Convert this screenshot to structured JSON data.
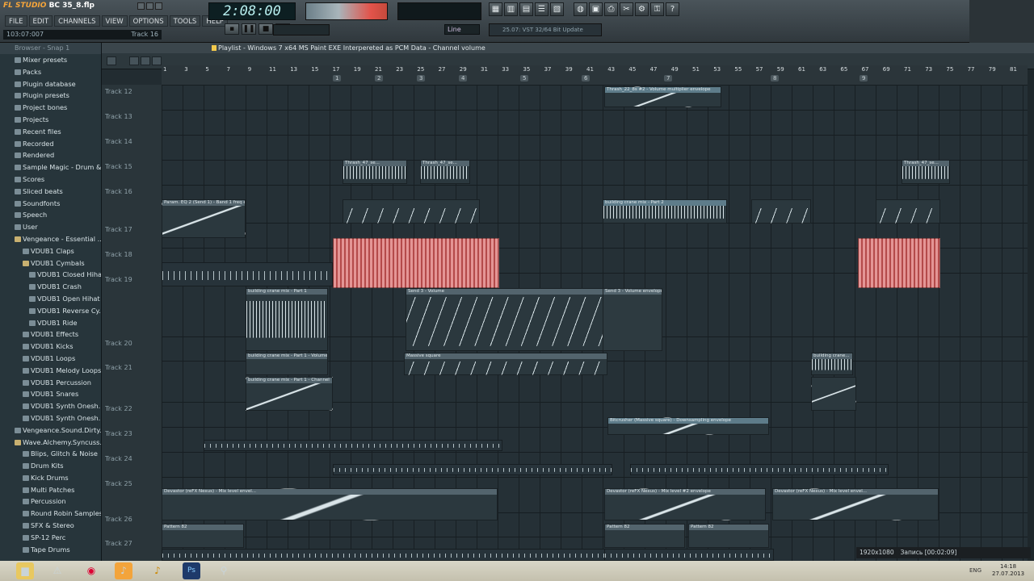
{
  "app": {
    "brand": "FL STUDIO",
    "project": "BC 35_8.flp",
    "hint_left": "103:07:007",
    "hint_right": "Track 16"
  },
  "menu": [
    "FILE",
    "EDIT",
    "CHANNELS",
    "VIEW",
    "OPTIONS",
    "TOOLS",
    "HELP"
  ],
  "transport": {
    "time": "2:08:00",
    "snap": "Line",
    "news": "25.07: VST 32/64 Bit Update"
  },
  "playlist": {
    "title": "Playlist - Windows 7 x64 MS Paint EXE Interpereted as PCM Data - Channel volume",
    "ruler_bars": [
      "1",
      "3",
      "5",
      "7",
      "9",
      "11",
      "13",
      "15",
      "17",
      "19",
      "21",
      "23",
      "25",
      "27",
      "29",
      "31",
      "33",
      "35",
      "37",
      "39",
      "41",
      "43",
      "45",
      "47",
      "49",
      "51",
      "53",
      "55",
      "57",
      "59",
      "61",
      "63",
      "65",
      "67",
      "69",
      "71",
      "73",
      "75",
      "77",
      "79",
      "81"
    ],
    "ruler_sections": [
      "1",
      "2",
      "3",
      "4",
      "5",
      "6",
      "7",
      "8",
      "9"
    ],
    "tracks": [
      "Track 12",
      "Track 13",
      "Track 14",
      "Track 15",
      "Track 16",
      "Track 17",
      "Track 18",
      "Track 19",
      "Track 20",
      "Track 21",
      "Track 22",
      "Track 23",
      "Track 24",
      "Track 25",
      "Track 26",
      "Track 27"
    ]
  },
  "clips": {
    "c1": "Thrash_22_8s #2 - Volume multiplier envelope",
    "c2": "Thrash_47_se...",
    "c3": "Param. EQ 2 (Send 1) - Band 1 freq e...",
    "c4": "building crane mix - Part 2",
    "c5": "building crane mix - Part 1",
    "c6": "Send 3 - Volume",
    "c7": "Send 3 - Volume envelope",
    "c8": "building crane mix - Part 1 - Volume",
    "c9": "Massive square",
    "c10": "building crane mix - Part 1 - Channel",
    "c11": "Bitcrusher (Massive square) - Downsampling envelope",
    "c12": "Devastor (reFX Nexus) - Mix level envel...",
    "c13": "Devastor (reFX Nexus) - Mix level #2 envelope",
    "c14": "Pattern 82",
    "c15": "building crane...",
    "c16": "Thrash_47_se..."
  },
  "browser": {
    "header": "Browser - Snap 1",
    "items": [
      {
        "label": "Mixer presets",
        "lvl": 0
      },
      {
        "label": "Packs",
        "lvl": 0
      },
      {
        "label": "Plugin database",
        "lvl": 0
      },
      {
        "label": "Plugin presets",
        "lvl": 0
      },
      {
        "label": "Project bones",
        "lvl": 0
      },
      {
        "label": "Projects",
        "lvl": 0
      },
      {
        "label": "Recent files",
        "lvl": 0
      },
      {
        "label": "Recorded",
        "lvl": 0
      },
      {
        "label": "Rendered",
        "lvl": 0
      },
      {
        "label": "Sample Magic - Drum & ...",
        "lvl": 0
      },
      {
        "label": "Scores",
        "lvl": 0
      },
      {
        "label": "Sliced beats",
        "lvl": 0
      },
      {
        "label": "Soundfonts",
        "lvl": 0
      },
      {
        "label": "Speech",
        "lvl": 0
      },
      {
        "label": "User",
        "lvl": 0
      },
      {
        "label": "Vengeance - Essential ...",
        "lvl": 0,
        "open": true
      },
      {
        "label": "VDUB1 Claps",
        "lvl": 1
      },
      {
        "label": "VDUB1 Cymbals",
        "lvl": 1,
        "open": true
      },
      {
        "label": "VDUB1 Closed Hihat",
        "lvl": 2
      },
      {
        "label": "VDUB1 Crash",
        "lvl": 2
      },
      {
        "label": "VDUB1 Open Hihat",
        "lvl": 2
      },
      {
        "label": "VDUB1 Reverse Cy...",
        "lvl": 2
      },
      {
        "label": "VDUB1 Ride",
        "lvl": 2
      },
      {
        "label": "VDUB1 Effects",
        "lvl": 1
      },
      {
        "label": "VDUB1 Kicks",
        "lvl": 1
      },
      {
        "label": "VDUB1 Loops",
        "lvl": 1
      },
      {
        "label": "VDUB1 Melody Loops",
        "lvl": 1
      },
      {
        "label": "VDUB1 Percussion",
        "lvl": 1
      },
      {
        "label": "VDUB1 Snares",
        "lvl": 1
      },
      {
        "label": "VDUB1 Synth Onesh...",
        "lvl": 1
      },
      {
        "label": "VDUB1 Synth Onesh...",
        "lvl": 1
      },
      {
        "label": "Vengeance.Sound.Dirty...",
        "lvl": 0
      },
      {
        "label": "Wave.Alchemy.Syncuss...",
        "lvl": 0,
        "open": true
      },
      {
        "label": "Blips, Glitch & Noise",
        "lvl": 1
      },
      {
        "label": "Drum Kits",
        "lvl": 1
      },
      {
        "label": "Kick Drums",
        "lvl": 1
      },
      {
        "label": "Multi Patches",
        "lvl": 1
      },
      {
        "label": "Percussion",
        "lvl": 1
      },
      {
        "label": "Round Robin Samples",
        "lvl": 1
      },
      {
        "label": "SFX & Stereo",
        "lvl": 1
      },
      {
        "label": "SP-12 Perc",
        "lvl": 1
      },
      {
        "label": "Tape Drums",
        "lvl": 1
      }
    ]
  },
  "recorder": {
    "res": "1920x1080",
    "rec": "Запись [00:02:09]"
  },
  "taskbar": {
    "lang": "ENG",
    "time": "14:18",
    "date": "27.07.2013"
  }
}
